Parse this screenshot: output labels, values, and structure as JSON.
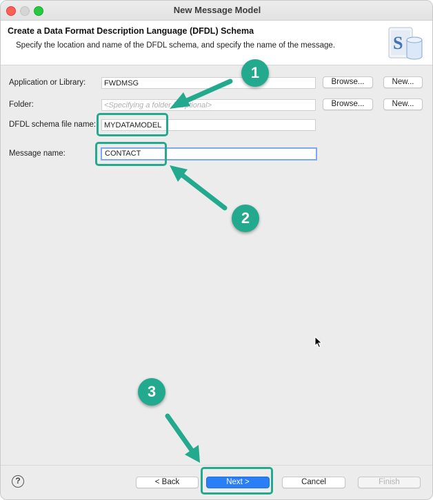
{
  "window": {
    "title": "New Message Model"
  },
  "header": {
    "title": "Create a Data Format Description Language (DFDL) Schema",
    "description": "Specify the location and name of the DFDL schema, and specify the name of the message.",
    "icon": "schema-database-icon"
  },
  "form": {
    "application": {
      "label": "Application or Library:",
      "value": "FWDMSG",
      "browse": "Browse...",
      "new": "New..."
    },
    "folder": {
      "label": "Folder:",
      "placeholder": "<Specifying a folder is optional>",
      "browse": "Browse...",
      "new": "New..."
    },
    "schema_file": {
      "label": "DFDL schema file name:",
      "value": "MYDATAMODEL"
    },
    "message_name": {
      "label": "Message name:",
      "value": "CONTACT"
    }
  },
  "footer": {
    "help": "?",
    "back": "< Back",
    "next": "Next >",
    "cancel": "Cancel",
    "finish": "Finish"
  },
  "annotations": {
    "step1": "1",
    "step2": "2",
    "step3": "3",
    "color": "#23a98e"
  }
}
